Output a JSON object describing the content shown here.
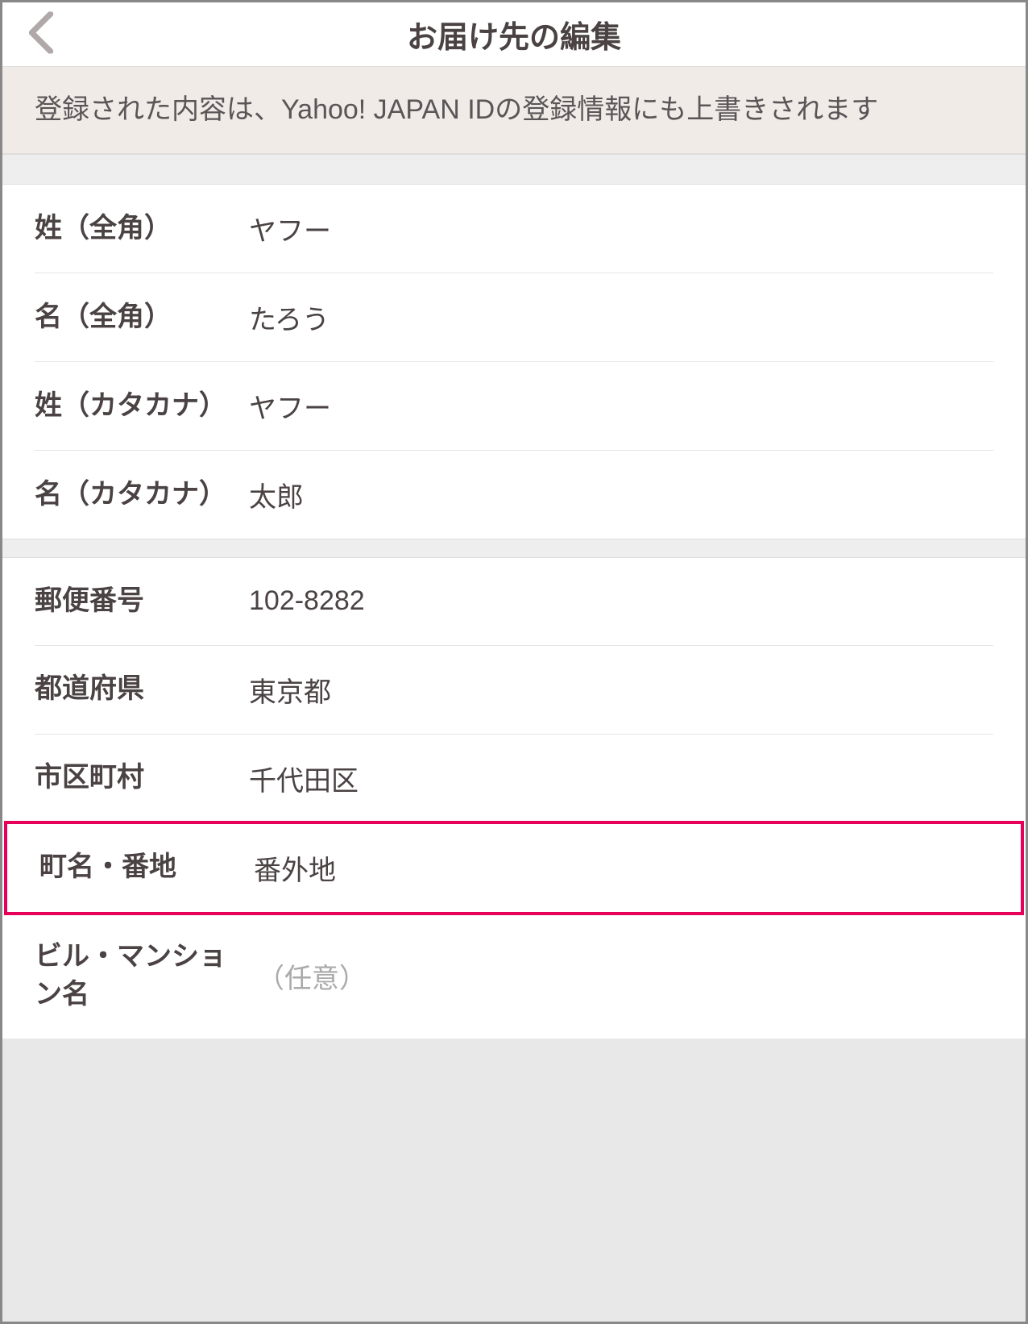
{
  "header": {
    "title": "お届け先の編集"
  },
  "notice": "登録された内容は、Yahoo! JAPAN IDの登録情報にも上書きされます",
  "name_section": {
    "last_name_label": "姓（全角）",
    "last_name_value": "ヤフー",
    "first_name_label": "名（全角）",
    "first_name_value": "たろう",
    "last_kana_label": "姓（カタカナ）",
    "last_kana_value": "ヤフー",
    "first_kana_label": "名（カタカナ）",
    "first_kana_value": "太郎"
  },
  "address_section": {
    "postal_label": "郵便番号",
    "postal_value": "102-8282",
    "prefecture_label": "都道府県",
    "prefecture_value": "東京都",
    "city_label": "市区町村",
    "city_value": "千代田区",
    "street_label": "町名・番地",
    "street_value": "番外地",
    "building_label": "ビル・マンション名",
    "building_placeholder": "（任意）"
  }
}
